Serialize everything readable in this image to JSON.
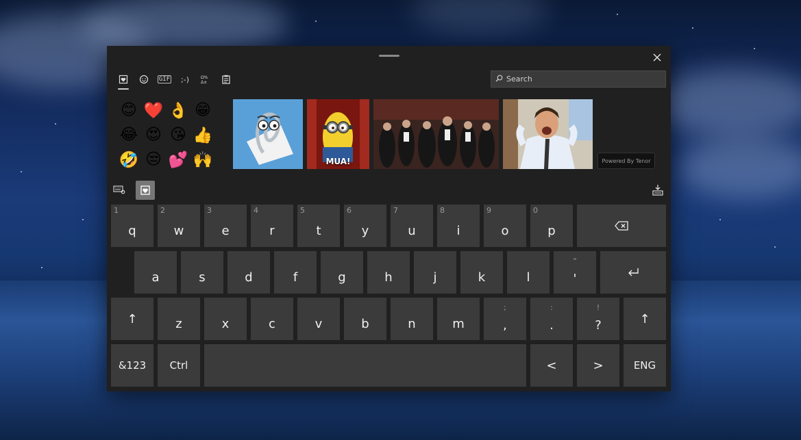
{
  "toolbar": {
    "tabs": [
      {
        "name": "favorites-tab",
        "icon": "heart-note-icon",
        "active": true
      },
      {
        "name": "emoji-tab",
        "icon": "smiley-icon",
        "active": false
      },
      {
        "name": "gif-tab",
        "icon": "gif-icon",
        "label": "GIF",
        "active": false
      },
      {
        "name": "kaomoji-tab",
        "icon": "kaomoji-icon",
        "label": ";-)",
        "active": false
      },
      {
        "name": "symbols-tab",
        "icon": "symbols-icon",
        "active": false
      },
      {
        "name": "clipboard-tab",
        "icon": "clipboard-icon",
        "active": false
      }
    ]
  },
  "search": {
    "placeholder": "Search"
  },
  "emojis": [
    "😊",
    "❤️",
    "👌",
    "😁",
    "😂",
    "😍",
    "😘",
    "👍",
    "🤣",
    "😒",
    "💕",
    "🙌"
  ],
  "gifs": [
    {
      "name": "clippy-gif",
      "caption": ""
    },
    {
      "name": "minion-gif",
      "caption": "MUA!"
    },
    {
      "name": "applause-crowd-gif",
      "caption": ""
    },
    {
      "name": "excited-man-gif",
      "caption": ""
    }
  ],
  "tenor": {
    "label": "Powered By Tenor"
  },
  "keyboard": {
    "row1": [
      {
        "sup": "1",
        "key": "q"
      },
      {
        "sup": "2",
        "key": "w"
      },
      {
        "sup": "3",
        "key": "e"
      },
      {
        "sup": "4",
        "key": "r"
      },
      {
        "sup": "5",
        "key": "t"
      },
      {
        "sup": "6",
        "key": "y"
      },
      {
        "sup": "7",
        "key": "u"
      },
      {
        "sup": "8",
        "key": "i"
      },
      {
        "sup": "9",
        "key": "o"
      },
      {
        "sup": "0",
        "key": "p"
      }
    ],
    "row2": [
      {
        "key": "a"
      },
      {
        "key": "s"
      },
      {
        "key": "d"
      },
      {
        "key": "f"
      },
      {
        "key": "g"
      },
      {
        "key": "h"
      },
      {
        "key": "j"
      },
      {
        "key": "k"
      },
      {
        "key": "l"
      }
    ],
    "apostrophe": {
      "sup": "\"",
      "key": "'"
    },
    "row3": [
      {
        "key": "z"
      },
      {
        "key": "x"
      },
      {
        "key": "c"
      },
      {
        "key": "v"
      },
      {
        "key": "b"
      },
      {
        "key": "n"
      },
      {
        "key": "m"
      }
    ],
    "punct": [
      {
        "sup": ";",
        "key": ","
      },
      {
        "sup": ":",
        "key": "."
      },
      {
        "sup": "!",
        "key": "?"
      }
    ],
    "backspace": "⌫",
    "enter": "↵",
    "shift": "↑",
    "sym": "&123",
    "ctrl": "Ctrl",
    "left": "<",
    "right": ">",
    "lang": "ENG"
  }
}
